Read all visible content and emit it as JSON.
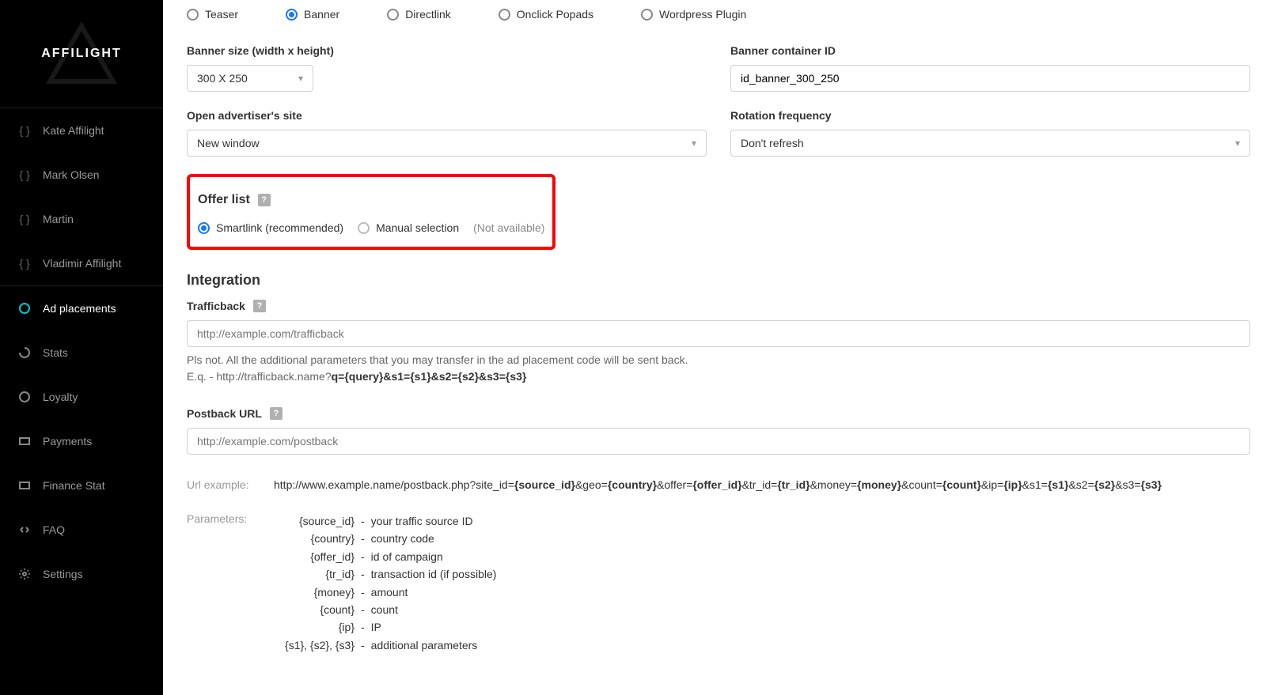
{
  "brand": "AFFILIGHT",
  "sidebar": {
    "users": [
      {
        "label": "Kate Affilight"
      },
      {
        "label": "Mark Olsen"
      },
      {
        "label": "Martin"
      },
      {
        "label": "Vladimir Affilight"
      }
    ],
    "items": [
      {
        "id": "ad-placements",
        "label": "Ad placements",
        "active": true
      },
      {
        "id": "stats",
        "label": "Stats"
      },
      {
        "id": "loyalty",
        "label": "Loyalty"
      },
      {
        "id": "payments",
        "label": "Payments"
      },
      {
        "id": "finance-stat",
        "label": "Finance Stat"
      },
      {
        "id": "faq",
        "label": "FAQ"
      },
      {
        "id": "settings",
        "label": "Settings"
      }
    ]
  },
  "ad_types": {
    "options": [
      {
        "id": "teaser",
        "label": "Teaser",
        "selected": false
      },
      {
        "id": "banner",
        "label": "Banner",
        "selected": true
      },
      {
        "id": "directlink",
        "label": "Directlink",
        "selected": false
      },
      {
        "id": "onclick",
        "label": "Onclick Popads",
        "selected": false
      },
      {
        "id": "wordpress",
        "label": "Wordpress Plugin",
        "selected": false
      }
    ]
  },
  "bannerSize": {
    "label": "Banner size (width x height)",
    "value": "300 X 250"
  },
  "bannerContainerId": {
    "label": "Banner container ID",
    "value": "id_banner_300_250"
  },
  "openSite": {
    "label": "Open advertiser's site",
    "value": "New window"
  },
  "rotation": {
    "label": "Rotation frequency",
    "value": "Don't refresh"
  },
  "offerList": {
    "title": "Offer list",
    "smartlink": "Smartlink (recommended)",
    "manual": "Manual selection",
    "notAvailable": "(Not available)"
  },
  "integration": {
    "title": "Integration",
    "trafficback": {
      "label": "Trafficback",
      "placeholder": "http://example.com/trafficback",
      "hint_pre": "Pls not. All the additional parameters that you may transfer in the ad placement code will be sent back.",
      "hint_eq": "E.q. - http://trafficback.name?",
      "hint_bold": "q={query}&s1={s1}&s2={s2}&s3={s3}"
    },
    "postback": {
      "label": "Postback URL",
      "placeholder": "http://example.com/postback"
    },
    "urlExample": {
      "label": "Url example:",
      "parts": [
        {
          "t": "http://www.example.name/postback.php?site_id=",
          "b": false
        },
        {
          "t": "{source_id}",
          "b": true
        },
        {
          "t": "&geo=",
          "b": false
        },
        {
          "t": "{country}",
          "b": true
        },
        {
          "t": "&offer=",
          "b": false
        },
        {
          "t": "{offer_id}",
          "b": true
        },
        {
          "t": "&tr_id=",
          "b": false
        },
        {
          "t": "{tr_id}",
          "b": true
        },
        {
          "t": "&money=",
          "b": false
        },
        {
          "t": "{money}",
          "b": true
        },
        {
          "t": "&count=",
          "b": false
        },
        {
          "t": "{count}",
          "b": true
        },
        {
          "t": "&ip=",
          "b": false
        },
        {
          "t": "{ip}",
          "b": true
        },
        {
          "t": "&s1=",
          "b": false
        },
        {
          "t": "{s1}",
          "b": true
        },
        {
          "t": "&s2=",
          "b": false
        },
        {
          "t": "{s2}",
          "b": true
        },
        {
          "t": "&s3=",
          "b": false
        },
        {
          "t": "{s3}",
          "b": true
        }
      ]
    },
    "parameters": {
      "label": "Parameters:",
      "rows": [
        {
          "k": "{source_id}",
          "v": "your traffic source ID"
        },
        {
          "k": "{country}",
          "v": "country code"
        },
        {
          "k": "{offer_id}",
          "v": "id of campaign"
        },
        {
          "k": "{tr_id}",
          "v": "transaction id (if possible)"
        },
        {
          "k": "{money}",
          "v": "amount"
        },
        {
          "k": "{count}",
          "v": "count"
        },
        {
          "k": "{ip}",
          "v": "IP"
        },
        {
          "k": "{s1}, {s2}, {s3}",
          "v": "additional parameters"
        }
      ]
    }
  }
}
